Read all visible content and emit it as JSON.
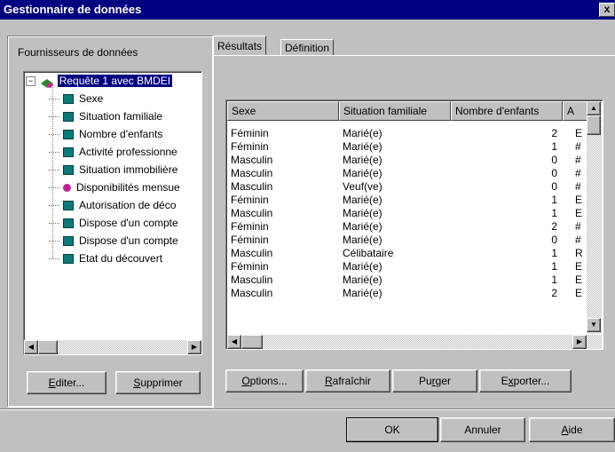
{
  "window": {
    "title": "Gestionnaire de données",
    "close_glyph": "x"
  },
  "left_panel": {
    "label": "Fournisseurs de données",
    "tree": {
      "root": {
        "label": "Requête 1 avec BMDEI",
        "expander": "−"
      },
      "children": [
        {
          "label": "Sexe",
          "icon": "dimension-icon"
        },
        {
          "label": "Situation familiale",
          "icon": "dimension-icon"
        },
        {
          "label": "Nombre d'enfants",
          "icon": "dimension-icon"
        },
        {
          "label": "Activité professionne",
          "icon": "dimension-icon"
        },
        {
          "label": "Situation immobilière",
          "icon": "dimension-icon"
        },
        {
          "label": "Disponibilités mensue",
          "icon": "measure-icon"
        },
        {
          "label": "Autorisation de déco",
          "icon": "dimension-icon"
        },
        {
          "label": "Dispose d'un compte",
          "icon": "dimension-icon"
        },
        {
          "label": "Dispose d'un compte",
          "icon": "dimension-icon"
        },
        {
          "label": "Etat du découvert",
          "icon": "dimension-icon"
        }
      ]
    },
    "buttons": {
      "edit_u": "E",
      "edit_rest": "diter...",
      "delete_u": "S",
      "delete_rest": "upprimer"
    }
  },
  "tabs": [
    {
      "label": "Résultats"
    },
    {
      "label": "Définition"
    }
  ],
  "grid": {
    "headers": [
      "Sexe",
      "Situation familiale",
      "Nombre d'enfants",
      "A"
    ],
    "rows": [
      [
        "Féminin",
        "Marié(e)",
        "2",
        "E"
      ],
      [
        "Féminin",
        "Marié(e)",
        "1",
        "#"
      ],
      [
        "Masculin",
        "Marié(e)",
        "0",
        "#"
      ],
      [
        "Masculin",
        "Marié(e)",
        "0",
        "#"
      ],
      [
        "Masculin",
        "Veuf(ve)",
        "0",
        "#"
      ],
      [
        "Féminin",
        "Marié(e)",
        "1",
        "E"
      ],
      [
        "Masculin",
        "Marié(e)",
        "1",
        "E"
      ],
      [
        "Féminin",
        "Marié(e)",
        "2",
        "#"
      ],
      [
        "Féminin",
        "Marié(e)",
        "0",
        "#"
      ],
      [
        "Masculin",
        "Célibataire",
        "1",
        "R"
      ],
      [
        "Féminin",
        "Marié(e)",
        "1",
        "E"
      ],
      [
        "Masculin",
        "Marié(e)",
        "1",
        "E"
      ],
      [
        "Masculin",
        "Marié(e)",
        "2",
        "E"
      ]
    ]
  },
  "grid_buttons": {
    "options_u": "O",
    "options_rest": "ptions...",
    "refresh_u": "R",
    "refresh_rest": "afraîchir",
    "purge_pre": "Pu",
    "purge_u": "r",
    "purge_rest": "ger",
    "export_pre": "E",
    "export_u": "x",
    "export_rest": "porter..."
  },
  "footer": {
    "ok": "OK",
    "cancel": "Annuler",
    "help_u": "A",
    "help_rest": "ide"
  }
}
